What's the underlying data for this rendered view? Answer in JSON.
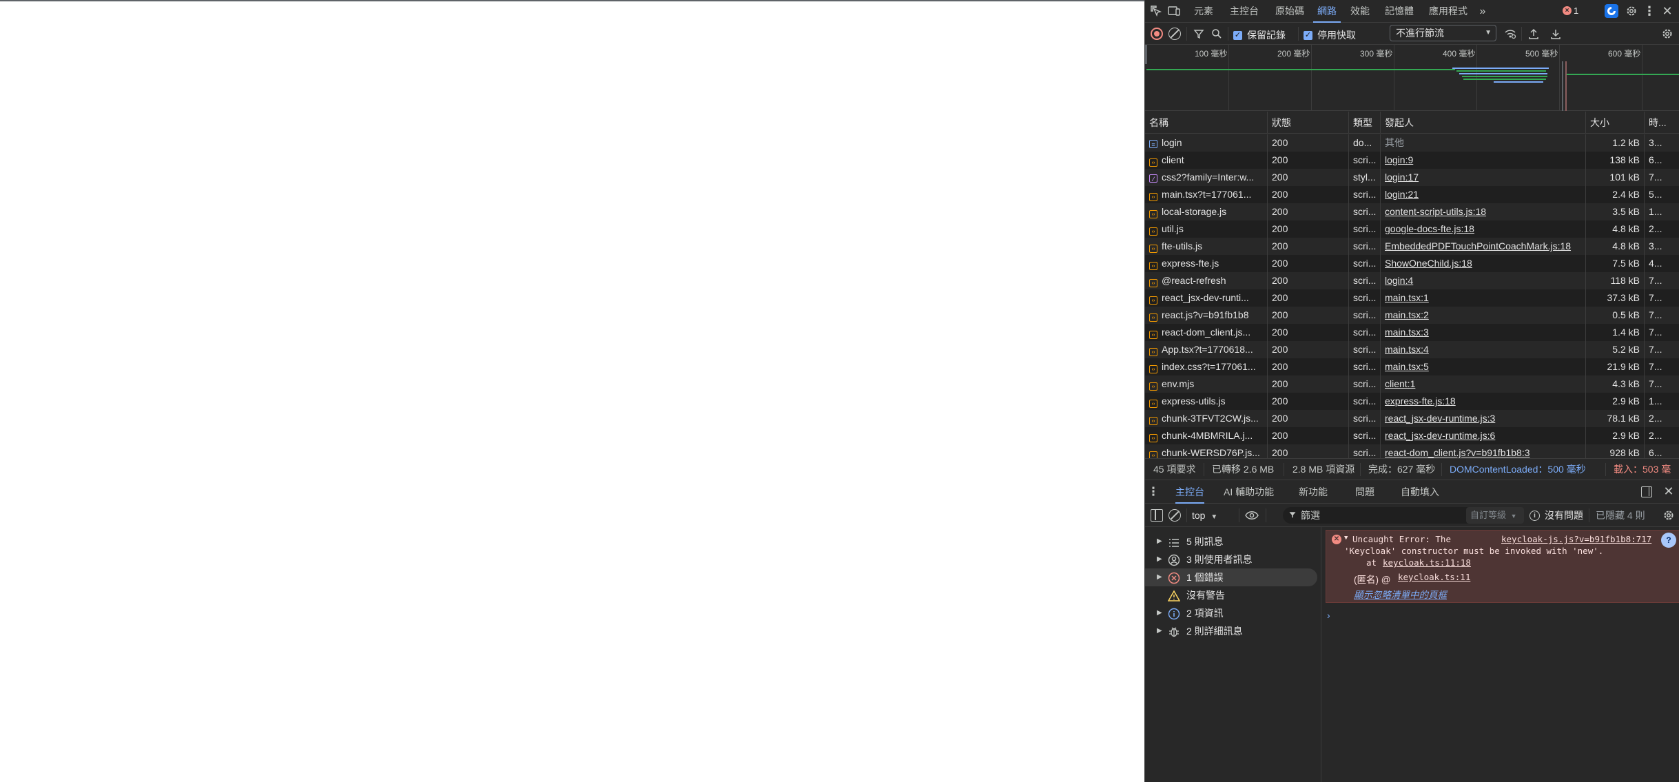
{
  "devtools": {
    "tabs": [
      "元素",
      "主控台",
      "原始碼",
      "網路",
      "效能",
      "記憶體",
      "應用程式"
    ],
    "active_tab": "網路",
    "more_tabs_icon": "chevron-double-right-icon",
    "error_count": "1",
    "ai_icon": "ai-assistance-icon",
    "settings_icon": "gear-icon",
    "menu_icon": "kebab-menu-icon",
    "close_icon": "close-icon"
  },
  "network_toolbar": {
    "preserve_log_label": "保留記錄",
    "preserve_log_checked": true,
    "disable_cache_label": "停用快取",
    "disable_cache_checked": true,
    "throttle_value": "不進行節流"
  },
  "overview": {
    "ticks": [
      "100 毫秒",
      "200 毫秒",
      "300 毫秒",
      "400 毫秒",
      "500 毫秒",
      "600 毫秒"
    ]
  },
  "table": {
    "columns": [
      "名稱",
      "狀態",
      "類型",
      "發起人",
      "大小",
      "時..."
    ],
    "rows": [
      {
        "name": "login",
        "status": "200",
        "type": "do...",
        "initiator": "其他",
        "initiator_link": false,
        "size": "1.2 kB",
        "time": "3...",
        "kind": "doc"
      },
      {
        "name": "client",
        "status": "200",
        "type": "scri...",
        "initiator": "login:9",
        "initiator_link": true,
        "size": "138 kB",
        "time": "6...",
        "kind": "script"
      },
      {
        "name": "css2?family=Inter:w...",
        "status": "200",
        "type": "styl...",
        "initiator": "login:17",
        "initiator_link": true,
        "size": "101 kB",
        "time": "7...",
        "kind": "style"
      },
      {
        "name": "main.tsx?t=177061...",
        "status": "200",
        "type": "scri...",
        "initiator": "login:21",
        "initiator_link": true,
        "size": "2.4 kB",
        "time": "5...",
        "kind": "script"
      },
      {
        "name": "local-storage.js",
        "status": "200",
        "type": "scri...",
        "initiator": "content-script-utils.js:18",
        "initiator_link": true,
        "size": "3.5 kB",
        "time": "1...",
        "kind": "script"
      },
      {
        "name": "util.js",
        "status": "200",
        "type": "scri...",
        "initiator": "google-docs-fte.js:18",
        "initiator_link": true,
        "size": "4.8 kB",
        "time": "2...",
        "kind": "script"
      },
      {
        "name": "fte-utils.js",
        "status": "200",
        "type": "scri...",
        "initiator": "EmbeddedPDFTouchPointCoachMark.js:18",
        "initiator_link": true,
        "size": "4.8 kB",
        "time": "3...",
        "kind": "script"
      },
      {
        "name": "express-fte.js",
        "status": "200",
        "type": "scri...",
        "initiator": "ShowOneChild.js:18",
        "initiator_link": true,
        "size": "7.5 kB",
        "time": "4...",
        "kind": "script"
      },
      {
        "name": "@react-refresh",
        "status": "200",
        "type": "scri...",
        "initiator": "login:4",
        "initiator_link": true,
        "size": "118 kB",
        "time": "7...",
        "kind": "script"
      },
      {
        "name": "react_jsx-dev-runti...",
        "status": "200",
        "type": "scri...",
        "initiator": "main.tsx:1",
        "initiator_link": true,
        "size": "37.3 kB",
        "time": "7...",
        "kind": "script"
      },
      {
        "name": "react.js?v=b91fb1b8",
        "status": "200",
        "type": "scri...",
        "initiator": "main.tsx:2",
        "initiator_link": true,
        "size": "0.5 kB",
        "time": "7...",
        "kind": "script"
      },
      {
        "name": "react-dom_client.js...",
        "status": "200",
        "type": "scri...",
        "initiator": "main.tsx:3",
        "initiator_link": true,
        "size": "1.4 kB",
        "time": "7...",
        "kind": "script"
      },
      {
        "name": "App.tsx?t=1770618...",
        "status": "200",
        "type": "scri...",
        "initiator": "main.tsx:4",
        "initiator_link": true,
        "size": "5.2 kB",
        "time": "7...",
        "kind": "script"
      },
      {
        "name": "index.css?t=177061...",
        "status": "200",
        "type": "scri...",
        "initiator": "main.tsx:5",
        "initiator_link": true,
        "size": "21.9 kB",
        "time": "7...",
        "kind": "script"
      },
      {
        "name": "env.mjs",
        "status": "200",
        "type": "scri...",
        "initiator": "client:1",
        "initiator_link": true,
        "size": "4.3 kB",
        "time": "7...",
        "kind": "script"
      },
      {
        "name": "express-utils.js",
        "status": "200",
        "type": "scri...",
        "initiator": "express-fte.js:18",
        "initiator_link": true,
        "size": "2.9 kB",
        "time": "1...",
        "kind": "script"
      },
      {
        "name": "chunk-3TFVT2CW.js...",
        "status": "200",
        "type": "scri...",
        "initiator": "react_jsx-dev-runtime.js:3",
        "initiator_link": true,
        "size": "78.1 kB",
        "time": "2...",
        "kind": "script"
      },
      {
        "name": "chunk-4MBMRILA.j...",
        "status": "200",
        "type": "scri...",
        "initiator": "react_jsx-dev-runtime.js:6",
        "initiator_link": true,
        "size": "2.9 kB",
        "time": "2...",
        "kind": "script"
      },
      {
        "name": "chunk-WERSD76P.js...",
        "status": "200",
        "type": "scri...",
        "initiator": "react-dom_client.js?v=b91fb1b8:3",
        "initiator_link": true,
        "size": "928 kB",
        "time": "6...",
        "kind": "script"
      }
    ]
  },
  "status_bar": {
    "requests": "45 項要求",
    "transferred": "已轉移 2.6 MB",
    "resources": "2.8 MB 項資源",
    "finish": "完成：627 毫秒",
    "dom_loaded": "DOMContentLoaded：500 毫秒",
    "load": "載入：503 毫"
  },
  "drawer": {
    "tabs": [
      "主控台",
      "AI 輔助功能",
      "新功能",
      "問題",
      "自動填入"
    ],
    "active_tab": "主控台",
    "context": "top",
    "filter_placeholder": "篩選",
    "level": "自訂等級",
    "issues": "沒有問題",
    "hidden": "已隱藏 4 則"
  },
  "console_sidebar": [
    {
      "label": "5 則訊息",
      "icon": "list-icon",
      "caret": true
    },
    {
      "label": "3 則使用者訊息",
      "icon": "user-icon",
      "caret": true
    },
    {
      "label": "1 個錯誤",
      "icon": "error-icon",
      "caret": true,
      "selected": true
    },
    {
      "label": "沒有警告",
      "icon": "warning-icon",
      "caret": false
    },
    {
      "label": "2 項資訊",
      "icon": "info-icon",
      "caret": true
    },
    {
      "label": "2 則詳細訊息",
      "icon": "bug-icon",
      "caret": true
    }
  ],
  "console_error": {
    "line1": "Uncaught Error: The",
    "source_link": "keycloak-js.js?v=b91fb1b8:717",
    "line2": "'Keycloak' constructor must be invoked with 'new'.",
    "at_prefix": "at",
    "at_link": "keycloak.ts:11:18",
    "anon_prefix": "(匿名) @",
    "anon_link": "keycloak.ts:11",
    "ignore_list_link": "顯示忽略清單中的頁框"
  },
  "colors": {
    "panel_bg": "#282828",
    "accent": "#7cacf8",
    "error_bg": "#4e3534",
    "error_icon": "#f28b82"
  }
}
